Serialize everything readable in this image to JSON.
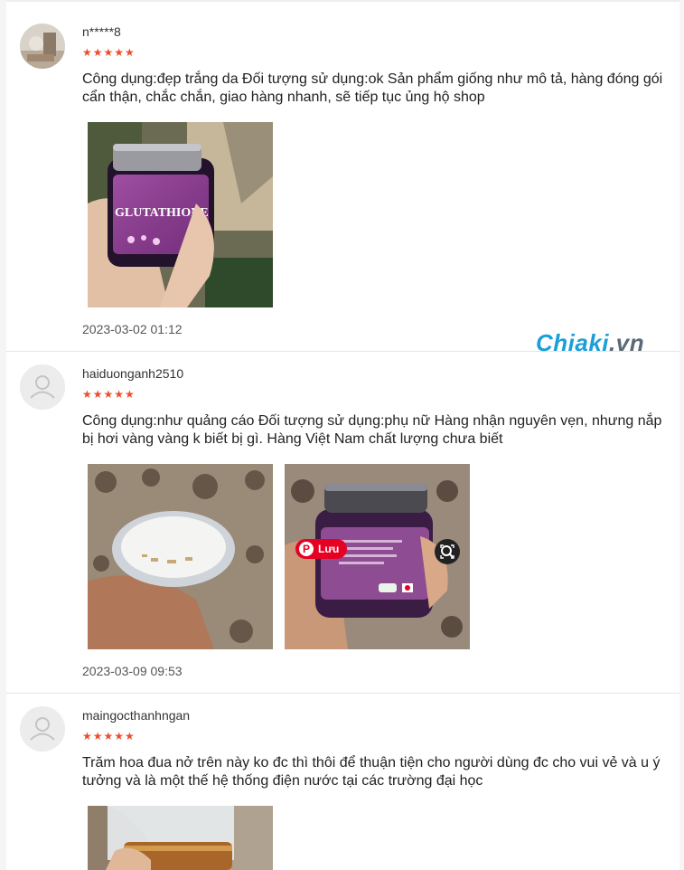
{
  "reviews": [
    {
      "username": "n*****8",
      "stars": "★★★★★",
      "comment": "Công dụng:đẹp trắng da Đối tượng sử dụng:ok Sản phẩm giống như mô tả, hàng đóng gói cẩn thận, chắc chắn, giao hàng nhanh, sẽ tiếp tục ủng hộ shop",
      "date": "2023-03-02 01:12",
      "product_label": "GLUTATHIONE"
    },
    {
      "username": "haiduonganh2510",
      "stars": "★★★★★",
      "comment": "Công dụng:như quảng cáo Đối tượng sử dụng:phụ nữ Hàng nhận nguyên vẹn, nhưng nắp bị hơi vàng vàng k biết bị gì. Hàng Việt Nam chất lượng chưa biết",
      "date": "2023-03-09 09:53",
      "pin_label": "Lưu",
      "pin_icon": "P"
    },
    {
      "username": "maingocthanhngan",
      "stars": "★★★★★",
      "comment": "Trăm hoa đua nở trên này ko đc thì thôi để thuận tiện cho người dùng đc cho vui vẻ và u ý tưởng và là một thế hệ thống điện nước tại các trường đại học"
    }
  ],
  "watermark": {
    "brand": "Chiaki",
    "tld": ".vn"
  },
  "colors": {
    "star": "#ee4d2d",
    "pinterest": "#e60023",
    "watermark": "#1a9fd8"
  }
}
